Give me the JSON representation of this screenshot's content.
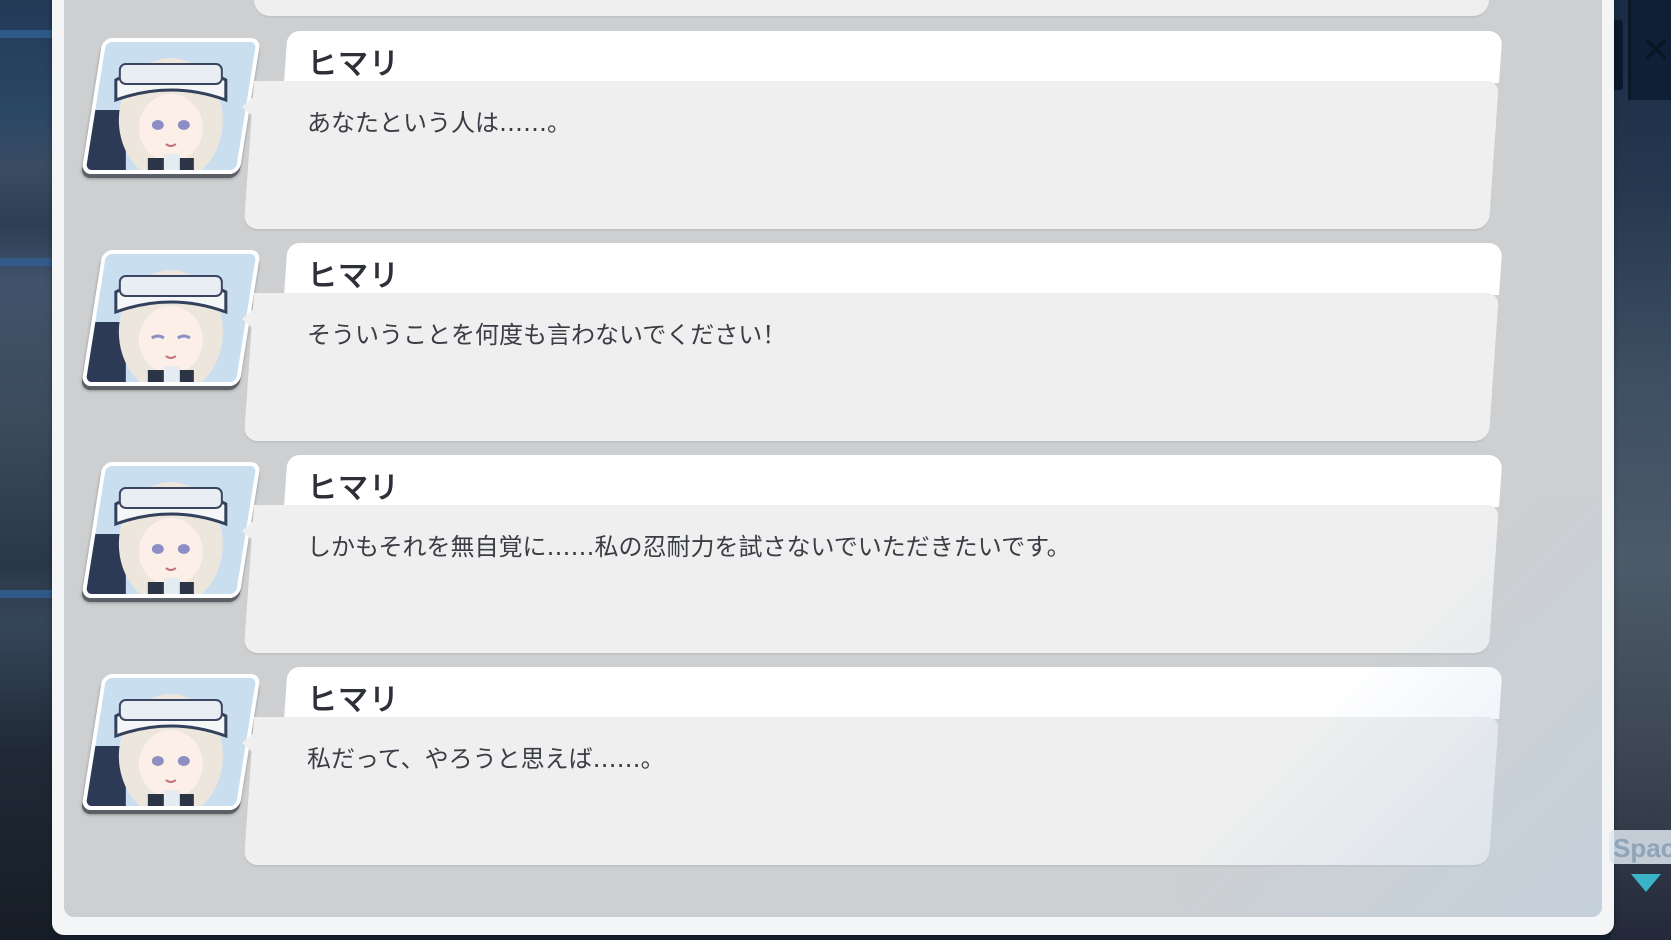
{
  "hud": {
    "space_hint": "Spac"
  },
  "log": {
    "entries": [
      {
        "speaker": "ヒマリ",
        "text": "あなたという人は……。"
      },
      {
        "speaker": "ヒマリ",
        "text": "そういうことを何度も言わないでください！"
      },
      {
        "speaker": "ヒマリ",
        "text": "しかもそれを無自覚に……私の忍耐力を試さないでいただきたいです。"
      },
      {
        "speaker": "ヒマリ",
        "text": "私だって、やろうと思えば……。"
      }
    ]
  },
  "colors": {
    "panel": "#cdcfd1",
    "bubble_body": "#efefef",
    "bubble_header": "#ffffff",
    "name_text": "#2d3038",
    "accent_arrow": "#3bb3c8"
  },
  "icons": {
    "portrait": "character-portrait-himari",
    "advance": "triangle-down-icon"
  }
}
